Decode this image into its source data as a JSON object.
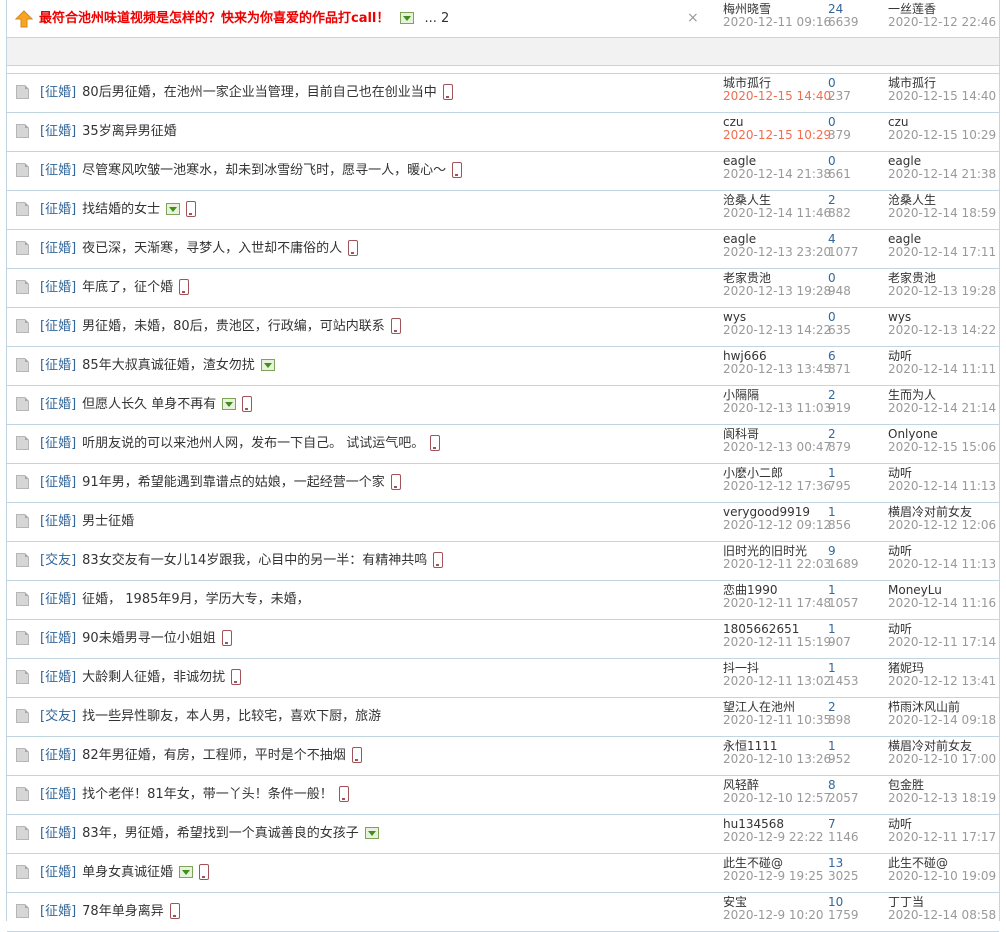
{
  "sticky": {
    "title": "最符合池州味道视频是怎样的？快来为你喜爱的作品打call！",
    "pages": "... 2",
    "author": "梅州晓雪",
    "date": "2020-12-11 09:16",
    "replies": "24",
    "views": "6639",
    "last_user": "一丝莲香",
    "last_date": "2020-12-12 22:46"
  },
  "threads": [
    {
      "cat": "[征婚]",
      "title": "80后男征婚，在池州一家企业当管理，目前自己也在创业当中",
      "img": false,
      "mobile": true,
      "author": "城市孤行",
      "date": "2020-12-15 14:40",
      "new": true,
      "replies": "0",
      "views": "237",
      "last_user": "城市孤行",
      "last_date": "2020-12-15 14:40"
    },
    {
      "cat": "[征婚]",
      "title": "35岁离异男征婚",
      "img": false,
      "mobile": false,
      "author": "czu",
      "date": "2020-12-15 10:29",
      "new": true,
      "replies": "0",
      "views": "379",
      "last_user": "czu",
      "last_date": "2020-12-15 10:29"
    },
    {
      "cat": "[征婚]",
      "title": "尽管寒风吹皱一池寒水，却未到冰雪纷飞时，愿寻一人，暖心～",
      "img": false,
      "mobile": true,
      "author": "eagle",
      "date": "2020-12-14 21:38",
      "new": false,
      "replies": "0",
      "views": "661",
      "last_user": "eagle",
      "last_date": "2020-12-14 21:38"
    },
    {
      "cat": "[征婚]",
      "title": "找结婚的女士",
      "img": true,
      "mobile": true,
      "author": "沧桑人生",
      "date": "2020-12-14 11:46",
      "new": false,
      "replies": "2",
      "views": "882",
      "last_user": "沧桑人生",
      "last_date": "2020-12-14 18:59"
    },
    {
      "cat": "[征婚]",
      "title": "夜已深，天渐寒，寻梦人，入世却不庸俗的人",
      "img": false,
      "mobile": true,
      "author": "eagle",
      "date": "2020-12-13 23:20",
      "new": false,
      "replies": "4",
      "views": "1077",
      "last_user": "eagle",
      "last_date": "2020-12-14 17:11"
    },
    {
      "cat": "[征婚]",
      "title": "年底了，征个婚",
      "img": false,
      "mobile": true,
      "author": "老家贵池",
      "date": "2020-12-13 19:28",
      "new": false,
      "replies": "0",
      "views": "948",
      "last_user": "老家贵池",
      "last_date": "2020-12-13 19:28"
    },
    {
      "cat": "[征婚]",
      "title": "男征婚，未婚，80后，贵池区，行政编，可站内联系",
      "img": false,
      "mobile": true,
      "author": "wys",
      "date": "2020-12-13 14:22",
      "new": false,
      "replies": "0",
      "views": "635",
      "last_user": "wys",
      "last_date": "2020-12-13 14:22"
    },
    {
      "cat": "[征婚]",
      "title": "85年大叔真诚征婚，渣女勿扰",
      "img": true,
      "mobile": false,
      "author": "hwj666",
      "date": "2020-12-13 13:45",
      "new": false,
      "replies": "6",
      "views": "871",
      "last_user": "动听",
      "last_date": "2020-12-14 11:11"
    },
    {
      "cat": "[征婚]",
      "title": "但愿人长久 单身不再有",
      "img": true,
      "mobile": true,
      "author": "小隔隔",
      "date": "2020-12-13 11:03",
      "new": false,
      "replies": "2",
      "views": "919",
      "last_user": "生而为人",
      "last_date": "2020-12-14 21:14"
    },
    {
      "cat": "[征婚]",
      "title": "听朋友说的可以来池州人网，发布一下自己。 试试运气吧。",
      "img": false,
      "mobile": true,
      "author": "阆科哥",
      "date": "2020-12-13 00:47",
      "new": false,
      "replies": "2",
      "views": "879",
      "last_user": "Onlyone",
      "last_date": "2020-12-15 15:06"
    },
    {
      "cat": "[征婚]",
      "title": "91年男，希望能遇到靠谱点的姑娘，一起经营一个家",
      "img": false,
      "mobile": true,
      "author": "小麽小二郎",
      "date": "2020-12-12 17:36",
      "new": false,
      "replies": "1",
      "views": "795",
      "last_user": "动听",
      "last_date": "2020-12-14 11:13"
    },
    {
      "cat": "[征婚]",
      "title": "男士征婚",
      "img": false,
      "mobile": false,
      "author": "verygood9919",
      "date": "2020-12-12 09:12",
      "new": false,
      "replies": "1",
      "views": "856",
      "last_user": "横眉冷对前女友",
      "last_date": "2020-12-12 12:06"
    },
    {
      "cat": "[交友]",
      "title": "83女交友有一女儿14岁跟我，心目中的另一半：有精神共鸣",
      "img": false,
      "mobile": true,
      "author": "旧时光的旧时光",
      "date": "2020-12-11 22:03",
      "new": false,
      "replies": "9",
      "views": "1689",
      "last_user": "动听",
      "last_date": "2020-12-14 11:13"
    },
    {
      "cat": "[征婚]",
      "title": "征婚， 1985年9月，学历大专，未婚，",
      "img": false,
      "mobile": false,
      "author": "恋曲1990",
      "date": "2020-12-11 17:48",
      "new": false,
      "replies": "1",
      "views": "1057",
      "last_user": "MoneyLu",
      "last_date": "2020-12-14 11:16"
    },
    {
      "cat": "[征婚]",
      "title": "90未婚男寻一位小姐姐",
      "img": false,
      "mobile": true,
      "author": "1805662651",
      "date": "2020-12-11 15:19",
      "new": false,
      "replies": "1",
      "views": "907",
      "last_user": "动听",
      "last_date": "2020-12-11 17:14"
    },
    {
      "cat": "[征婚]",
      "title": "大龄剩人征婚，非诚勿扰",
      "img": false,
      "mobile": true,
      "author": "抖一抖",
      "date": "2020-12-11 13:02",
      "new": false,
      "replies": "1",
      "views": "1453",
      "last_user": "猪妮玛",
      "last_date": "2020-12-12 13:41"
    },
    {
      "cat": "[交友]",
      "title": "找一些异性聊友，本人男，比较宅，喜欢下厨，旅游",
      "img": false,
      "mobile": false,
      "author": "望江人在池州",
      "date": "2020-12-11 10:35",
      "new": false,
      "replies": "2",
      "views": "898",
      "last_user": "栉雨沐风山前",
      "last_date": "2020-12-14 09:18"
    },
    {
      "cat": "[征婚]",
      "title": "82年男征婚，有房，工程师，平时是个不抽烟",
      "img": false,
      "mobile": true,
      "author": "永恒1111",
      "date": "2020-12-10 13:26",
      "new": false,
      "replies": "1",
      "views": "952",
      "last_user": "横眉冷对前女友",
      "last_date": "2020-12-10 17:00"
    },
    {
      "cat": "[征婚]",
      "title": "找个老伴！81年女，带一丫头！条件一般！",
      "img": false,
      "mobile": true,
      "author": "风轻醉",
      "date": "2020-12-10 12:57",
      "new": false,
      "replies": "8",
      "views": "2057",
      "last_user": "包金胜",
      "last_date": "2020-12-13 18:19"
    },
    {
      "cat": "[征婚]",
      "title": "83年，男征婚，希望找到一个真诚善良的女孩子",
      "img": true,
      "mobile": false,
      "author": "hu134568",
      "date": "2020-12-9 22:22",
      "new": false,
      "replies": "7",
      "views": "1146",
      "last_user": "动听",
      "last_date": "2020-12-11 17:17"
    },
    {
      "cat": "[征婚]",
      "title": "单身女真诚征婚",
      "img": true,
      "mobile": true,
      "author": "此生不碰@",
      "date": "2020-12-9 19:25",
      "new": false,
      "replies": "13",
      "views": "3025",
      "last_user": "此生不碰@",
      "last_date": "2020-12-10 19:09"
    },
    {
      "cat": "[征婚]",
      "title": "78年单身离异",
      "img": false,
      "mobile": true,
      "author": "安宝",
      "date": "2020-12-9 10:20",
      "new": false,
      "replies": "10",
      "views": "1759",
      "last_user": "丁丁当",
      "last_date": "2020-12-14 08:58"
    }
  ]
}
